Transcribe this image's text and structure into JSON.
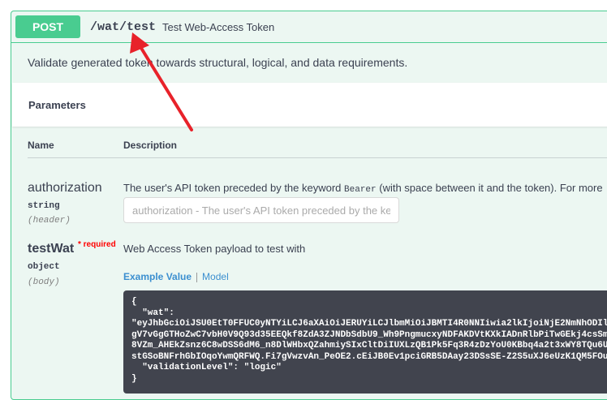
{
  "operation": {
    "method": "POST",
    "path": "/wat/test",
    "summary": "Test Web-Access Token",
    "description": "Validate generated token towards structural, logical, and data requirements."
  },
  "parameters": {
    "title": "Parameters",
    "columns": {
      "name": "Name",
      "description": "Description"
    },
    "items": [
      {
        "name": "authorization",
        "type": "string",
        "in": "(header)",
        "description_pre": "The user's API token preceded by the keyword ",
        "description_code": "Bearer",
        "description_post": " (with space between it and the token). For more",
        "placeholder": "authorization - The user's API token preceded by the ke"
      },
      {
        "name": "testWat",
        "required_marker": "* required",
        "type": "object",
        "in": "(body)",
        "description": "Web Access Token payload to test with"
      }
    ]
  },
  "example": {
    "tab_example": "Example Value",
    "tab_model": "Model",
    "lines": [
      "{",
      "  \"wat\":",
      "\"eyJhbGciOiJSU0EtT0FFUC0yNTYiLCJ6aXAiOiJERUYiLCJlbmMiOiJBMTI4R0NNIiwia2lkIjoiNjE2NmNhODIl",
      "gV7vGgGTHoZwC7vbH0V9Q93d35EEQkf8ZdA3ZJNDbSdbU9_Wh9PngmucxyNDFAKDVtKXkIADnRlbPiTwGEkj4csSm",
      "8VZm_AHEkZsnz6C8wDSS6dM6_n8DlWHbxQZahmiySIxCltDiIUXLzQB1Pk5Fq3R4zDzYoU0KBbq4a2t3xWY8TQu6U",
      "stGSoBNFrhGbIOqoYwmQRFWQ.Fi7gVwzvAn_PeOE2.cEiJB0Ev1pciGRB5DAay23DSsSE-Z2S5uXJ6eUzK1QM5FOu",
      "  \"validationLevel\": \"logic\"",
      "}"
    ]
  },
  "colors": {
    "post": "#49cc90",
    "annotation": "#e8222a"
  }
}
